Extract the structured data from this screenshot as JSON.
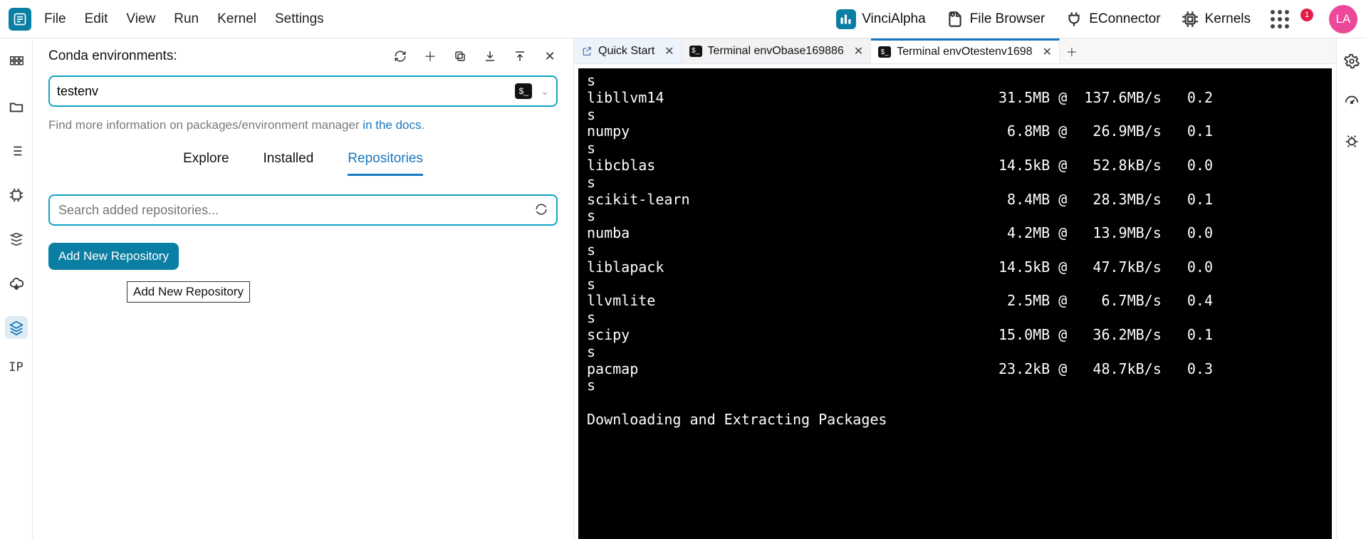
{
  "menu": {
    "file": "File",
    "edit": "Edit",
    "view": "View",
    "run": "Run",
    "kernel": "Kernel",
    "settings": "Settings"
  },
  "topright": {
    "vinci": "VinciAlpha",
    "file_browser": "File Browser",
    "econnector": "EConnector",
    "kernels": "Kernels",
    "bell_count": "1",
    "avatar": "LA"
  },
  "left_rail": {
    "ip": "IP"
  },
  "conda": {
    "title": "Conda environments:",
    "env_value": "testenv",
    "docs_prefix": "Find more information on packages/environment manager ",
    "docs_link": "in the docs",
    "docs_suffix": ".",
    "tabs": {
      "explore": "Explore",
      "installed": "Installed",
      "repositories": "Repositories"
    },
    "search_placeholder": "Search added repositories...",
    "add_repo": "Add New Repository",
    "tooltip": "Add New Repository"
  },
  "doc_tabs": {
    "quick_start": "Quick Start",
    "term1": "Terminal envObase169886",
    "term2": "Terminal envOtestenv1698"
  },
  "terminal_rows": [
    {
      "s": true
    },
    {
      "name": "libllvm14",
      "size": "31.5MB",
      "rate": "137.6MB/s",
      "t": "0.2"
    },
    {
      "s": true
    },
    {
      "name": "numpy",
      "size": "6.8MB",
      "rate": "26.9MB/s",
      "t": "0.1"
    },
    {
      "s": true
    },
    {
      "name": "libcblas",
      "size": "14.5kB",
      "rate": "52.8kB/s",
      "t": "0.0"
    },
    {
      "s": true
    },
    {
      "name": "scikit-learn",
      "size": "8.4MB",
      "rate": "28.3MB/s",
      "t": "0.1"
    },
    {
      "s": true
    },
    {
      "name": "numba",
      "size": "4.2MB",
      "rate": "13.9MB/s",
      "t": "0.0"
    },
    {
      "s": true
    },
    {
      "name": "liblapack",
      "size": "14.5kB",
      "rate": "47.7kB/s",
      "t": "0.0"
    },
    {
      "s": true
    },
    {
      "name": "llvmlite",
      "size": "2.5MB",
      "rate": "6.7MB/s",
      "t": "0.4"
    },
    {
      "s": true
    },
    {
      "name": "scipy",
      "size": "15.0MB",
      "rate": "36.2MB/s",
      "t": "0.1"
    },
    {
      "s": true
    },
    {
      "name": "pacmap",
      "size": "23.2kB",
      "rate": "48.7kB/s",
      "t": "0.3"
    },
    {
      "s": true
    },
    {
      "blank": true
    },
    {
      "footer": "Downloading and Extracting Packages"
    }
  ]
}
